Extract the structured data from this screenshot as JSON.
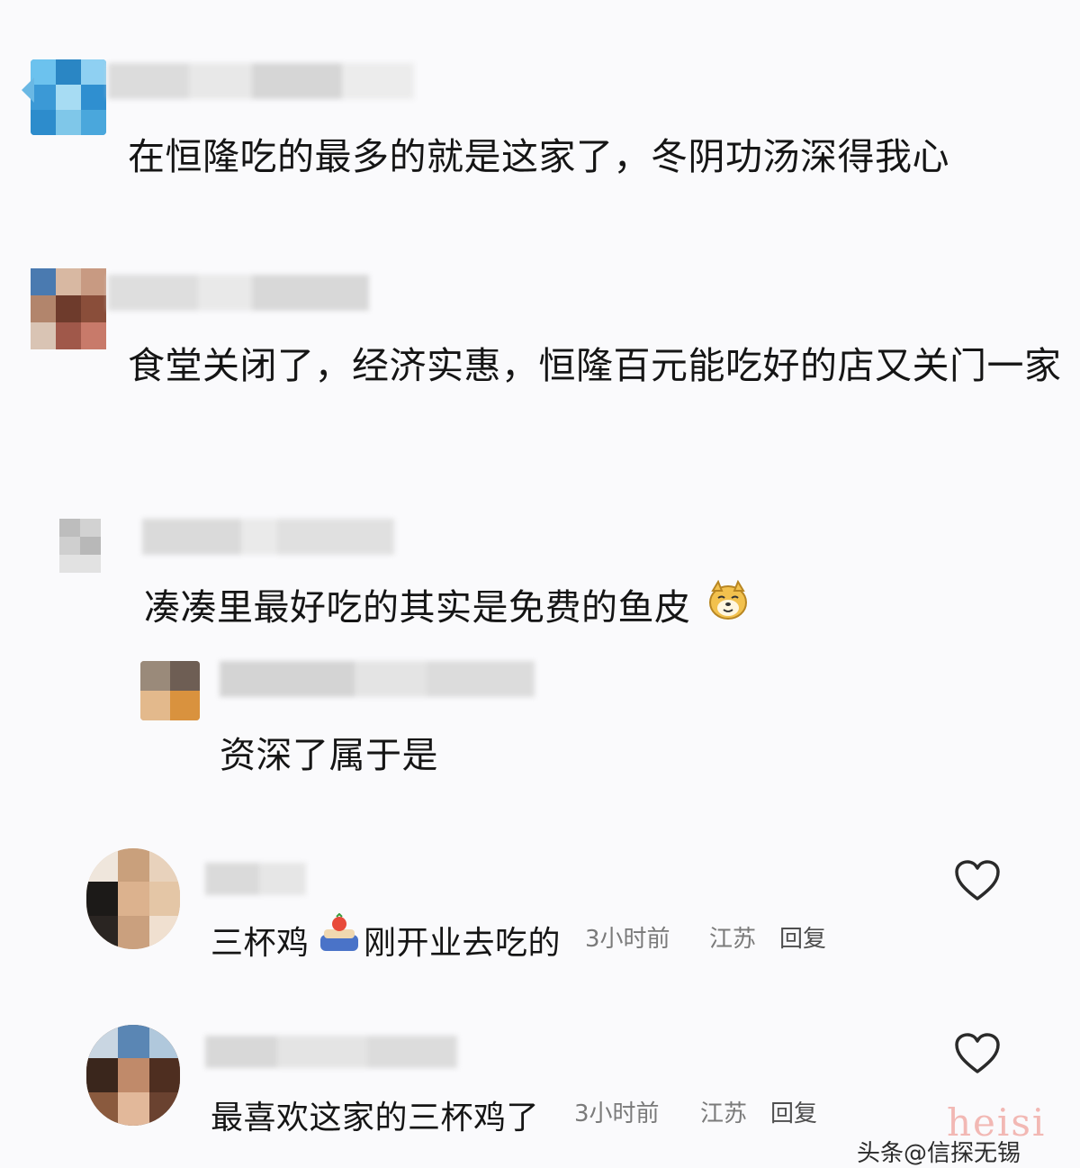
{
  "comments": [
    {
      "text": "在恒隆吃的最多的就是这家了，冬阴功汤深得我心"
    },
    {
      "text": "食堂关闭了，经济实惠，恒隆百元能吃好的店又关门一家"
    },
    {
      "text": "凑凑里最好吃的其实是免费的鱼皮",
      "emoji": "doge-emoji",
      "reply": {
        "text": "资深了属于是"
      }
    },
    {
      "text_before": "三杯鸡",
      "emoji": "cake-emoji",
      "text_after": "刚开业去吃的",
      "time": "3小时前",
      "location": "江苏",
      "reply_label": "回复",
      "like_icon": "heart-icon"
    },
    {
      "text": "最喜欢这家的三杯鸡了",
      "time": "3小时前",
      "location": "江苏",
      "reply_label": "回复",
      "like_icon": "heart-icon"
    }
  ],
  "watermark": {
    "brand": "头条@信探无锡",
    "overlay": "heisi",
    "overlay_color": "#f2b8b4"
  }
}
